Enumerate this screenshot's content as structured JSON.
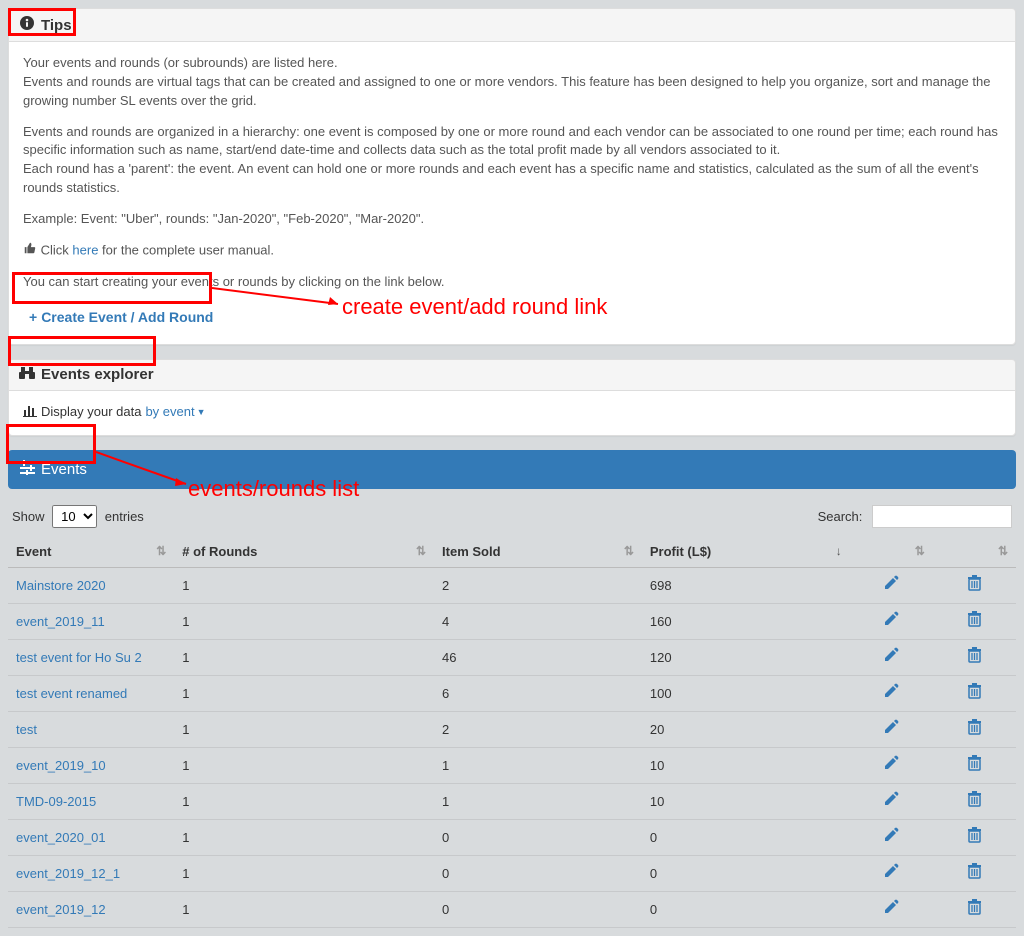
{
  "tips": {
    "title": "Tips",
    "p1": "Your events and rounds (or subrounds) are listed here.",
    "p2": "Events and rounds are virtual tags that can be created and assigned to one or more vendors. This feature has been designed to help you organize, sort and manage the growing number SL events over the grid.",
    "p3": "Events and rounds are organized in a hierarchy: one event is composed by one or more round and each vendor can be associated to one round per time; each round has specific information such as name, start/end date-time and collects data such as the total profit made by all vendors associated to it.",
    "p4": "Each round has a 'parent': the event. An event can hold one or more rounds and each event has a specific name and statistics, calculated as the sum of all the event's rounds statistics.",
    "p5": "Example: Event: \"Uber\", rounds: \"Jan-2020\", \"Feb-2020\", \"Mar-2020\".",
    "click_label": "Click ",
    "here_label": "here",
    "manual_tail": " for the complete user manual.",
    "p6": "You can start creating your events or rounds by clicking on the link below.",
    "create_label": "Create Event / Add Round"
  },
  "explorer": {
    "title": "Events explorer",
    "display_label": "Display your data ",
    "by_event": "by event"
  },
  "events_bar": {
    "label": "Events"
  },
  "table": {
    "show_label": "Show",
    "entries_label": "entries",
    "page_size": "10",
    "search_label": "Search:",
    "columns": {
      "event": "Event",
      "rounds": "# of Rounds",
      "item_sold": "Item Sold",
      "profit": "Profit (L$)"
    },
    "rows": [
      {
        "event": "Mainstore 2020",
        "rounds": "1",
        "item_sold": "2",
        "profit": "698"
      },
      {
        "event": "event_2019_11",
        "rounds": "1",
        "item_sold": "4",
        "profit": "160"
      },
      {
        "event": "test event for Ho Su 2",
        "rounds": "1",
        "item_sold": "46",
        "profit": "120"
      },
      {
        "event": "test event renamed",
        "rounds": "1",
        "item_sold": "6",
        "profit": "100"
      },
      {
        "event": "test",
        "rounds": "1",
        "item_sold": "2",
        "profit": "20"
      },
      {
        "event": "event_2019_10",
        "rounds": "1",
        "item_sold": "1",
        "profit": "10"
      },
      {
        "event": "TMD-09-2015",
        "rounds": "1",
        "item_sold": "1",
        "profit": "10"
      },
      {
        "event": "event_2020_01",
        "rounds": "1",
        "item_sold": "0",
        "profit": "0"
      },
      {
        "event": "event_2019_12_1",
        "rounds": "1",
        "item_sold": "0",
        "profit": "0"
      },
      {
        "event": "event_2019_12",
        "rounds": "1",
        "item_sold": "0",
        "profit": "0"
      }
    ]
  },
  "annotations": {
    "create_link": "create event/add round link",
    "events_list": "events/rounds list"
  },
  "icons": {
    "pencil": "pencil-icon",
    "trash": "trash-icon"
  }
}
